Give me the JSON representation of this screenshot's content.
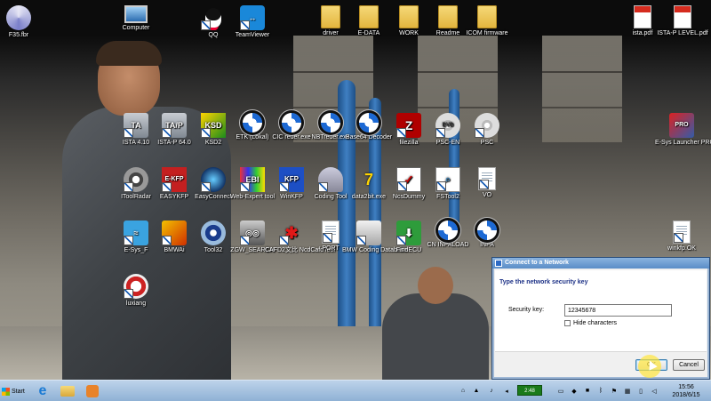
{
  "desktop": {
    "icons": [
      {
        "label": "F35.fbr",
        "icon": "app-icon"
      },
      {
        "label": "Computer",
        "icon": "computer-icon"
      },
      {
        "label": "QQ",
        "icon": "qq-icon"
      },
      {
        "label": "TeamViewer",
        "icon": "teamviewer-icon"
      },
      {
        "label": "driver",
        "icon": "folder-icon"
      },
      {
        "label": "E-DATA",
        "icon": "folder-icon"
      },
      {
        "label": "WORK",
        "icon": "folder-icon"
      },
      {
        "label": "Readme",
        "icon": "folder-icon"
      },
      {
        "label": "ICOM firmware",
        "icon": "folder-icon"
      },
      {
        "label": "ista.pdf",
        "icon": "pdf-icon"
      },
      {
        "label": "ISTA-P LEVEL.pdf",
        "icon": "pdf-icon"
      },
      {
        "label": "ISTA 4.10",
        "icon": "ista-icon"
      },
      {
        "label": "ISTA-P 64.0",
        "icon": "ista-p-icon"
      },
      {
        "label": "KSD2",
        "icon": "ksd2-icon"
      },
      {
        "label": "ETK (Lokal)",
        "icon": "bmw-icon"
      },
      {
        "label": "CIC reder.exe",
        "icon": "bmw-icon"
      },
      {
        "label": "NBTreder.exe",
        "icon": "bmw-icon"
      },
      {
        "label": "Base64 Decoder",
        "icon": "bmw-icon"
      },
      {
        "label": "filezilla",
        "icon": "filezilla-icon"
      },
      {
        "label": "PSC-EN",
        "icon": "dvd-icon"
      },
      {
        "label": "PSC",
        "icon": "dvd-icon"
      },
      {
        "label": "E-Sys Launcher PRO",
        "icon": "esys-launcher-icon"
      },
      {
        "label": "IToolRadar",
        "icon": "itoolradar-icon"
      },
      {
        "label": "EASYKFP",
        "icon": "easykfp-icon"
      },
      {
        "label": "EasyConnect",
        "icon": "easyconnect-icon"
      },
      {
        "label": "Web-Expert tool",
        "icon": "web-expert-icon"
      },
      {
        "label": "WinKFP",
        "icon": "winkfp-icon"
      },
      {
        "label": "Coding Tool",
        "icon": "coding-tool-icon"
      },
      {
        "label": "data2bit.exe",
        "icon": "data2bit-icon"
      },
      {
        "label": "NcsDummy",
        "icon": "ncsdummy-icon"
      },
      {
        "label": "FSTool2",
        "icon": "fstool-icon"
      },
      {
        "label": "VO",
        "icon": "document-icon"
      },
      {
        "label": "E-Sys_F",
        "icon": "esys-icon"
      },
      {
        "label": "BMWAi",
        "icon": "bmwai-icon"
      },
      {
        "label": "Tool32",
        "icon": "tool32-icon"
      },
      {
        "label": "ZGW_SEARCH",
        "icon": "zgw-search-icon"
      },
      {
        "label": "CAFD2文比 NcdCafdTool",
        "icon": "cafd-icon"
      },
      {
        "label": "PORT",
        "icon": "document-icon"
      },
      {
        "label": "BMW Coding Database",
        "icon": "database-icon"
      },
      {
        "label": "FindECU",
        "icon": "findecu-icon"
      },
      {
        "label": "CN INPALOAD",
        "icon": "bmw-icon"
      },
      {
        "label": "INPA",
        "icon": "bmw-icon"
      },
      {
        "label": "winkfp.OK",
        "icon": "document-icon"
      },
      {
        "label": "luxiang",
        "icon": "luxiang-icon"
      }
    ]
  },
  "dialog": {
    "title": "Connect to a Network",
    "heading": "Type the network security key",
    "key_label": "Security key:",
    "key_value": "12345678",
    "hide_label": "Hide characters",
    "hide_checked": false,
    "ok_label": "OK",
    "cancel_label": "Cancel"
  },
  "taskbar": {
    "start_label": "Start",
    "battery_text": "2:48",
    "time": "15:56",
    "date": "2018/6/15"
  },
  "colors": {
    "taskbar": "#8fb1d5",
    "dialog_heading": "#1e3287",
    "bmw_blue": "#1c69d4"
  }
}
